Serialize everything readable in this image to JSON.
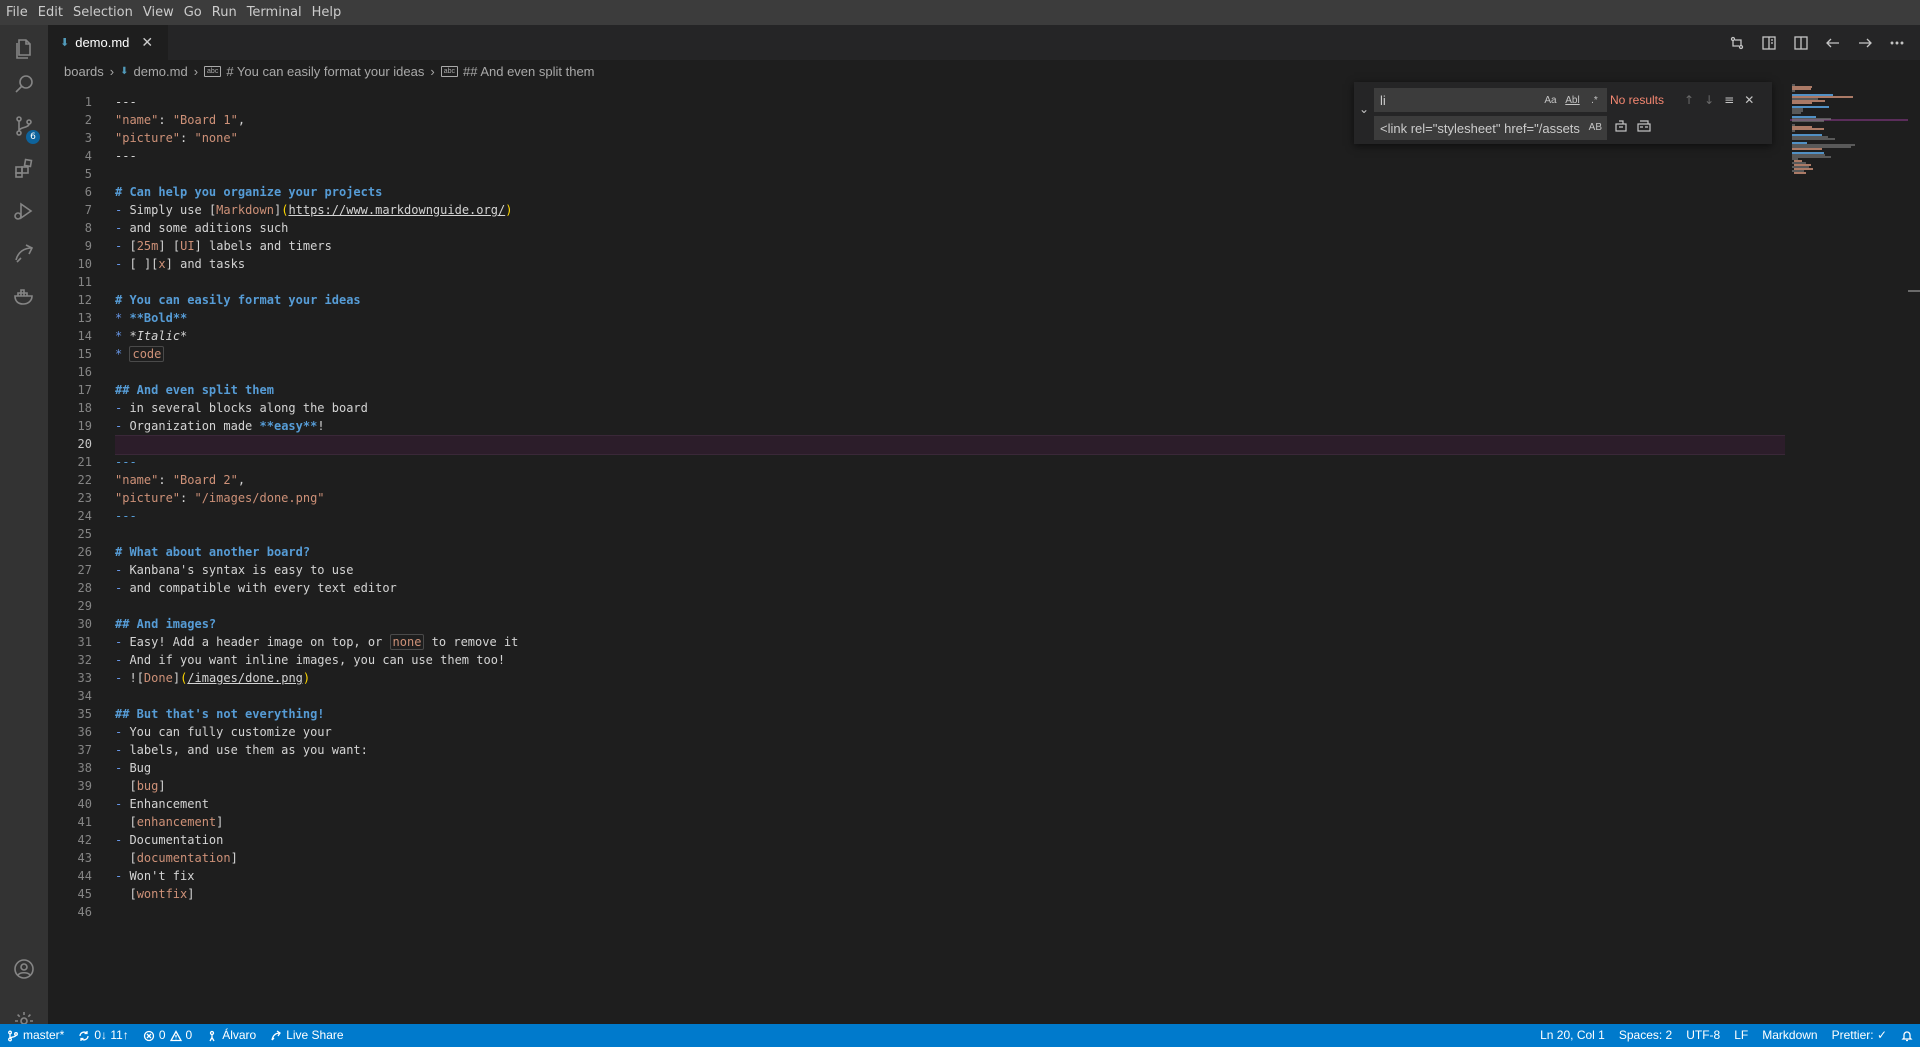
{
  "menu": [
    "File",
    "Edit",
    "Selection",
    "View",
    "Go",
    "Run",
    "Terminal",
    "Help"
  ],
  "activity": {
    "scm_badge": "6"
  },
  "tab": {
    "label": "demo.md"
  },
  "breadcrumb": {
    "folder": "boards",
    "file": "demo.md",
    "section1": "# You can easily format your ideas",
    "section2": "## And even split them"
  },
  "find": {
    "search_value": "li",
    "match_case": "Aa",
    "whole_word": "Abl",
    "regex": ".*",
    "no_results": "No results",
    "replace_value": "<link rel=\"stylesheet\" href=\"/assets",
    "preserve_case": "AB"
  },
  "editor": {
    "current_line": 20,
    "lines": [
      "---",
      "\"name\": \"Board 1\",",
      "\"picture\": \"none\"",
      "---",
      "",
      "# Can help you organize your projects",
      "- Simply use [Markdown](https://www.markdownguide.org/)",
      "- and some aditions such",
      "- [25m] [UI] labels and timers",
      "- [ ][x] and tasks",
      "",
      "# You can easily format your ideas",
      "* **Bold**",
      "* *Italic*",
      "* `code`",
      "",
      "## And even split them",
      "- in several blocks along the board",
      "- Organization made **easy**!",
      "",
      "---",
      "\"name\": \"Board 2\",",
      "\"picture\": \"/images/done.png\"",
      "---",
      "",
      "# What about another board?",
      "- Kanbana's syntax is easy to use",
      "- and compatible with every text editor",
      "",
      "## And images?",
      "- Easy! Add a header image on top, or `none` to remove it",
      "- And if you want inline images, you can use them too!",
      "- ![Done](/images/done.png)",
      "",
      "## But that's not everything!",
      "- You can fully customize your",
      "- labels, and use them as you want:",
      "- Bug",
      "  [bug]",
      "- Enhancement",
      "  [enhancement]",
      "- Documentation",
      "  [documentation]",
      "- Won't fix",
      "  [wontfix]",
      ""
    ]
  },
  "status": {
    "branch": "master*",
    "sync": "0↓ 11↑",
    "errors": "0",
    "warnings": "0",
    "user": "Álvaro",
    "liveshare": "Live Share",
    "position": "Ln 20, Col 1",
    "spaces": "Spaces: 2",
    "encoding": "UTF-8",
    "eol": "LF",
    "language": "Markdown",
    "prettier": "Prettier: ✓"
  },
  "colors": {
    "accent": "#007acc",
    "heading": "#569cd6",
    "string": "#ce9178",
    "current_line": "#2c1d2a"
  }
}
